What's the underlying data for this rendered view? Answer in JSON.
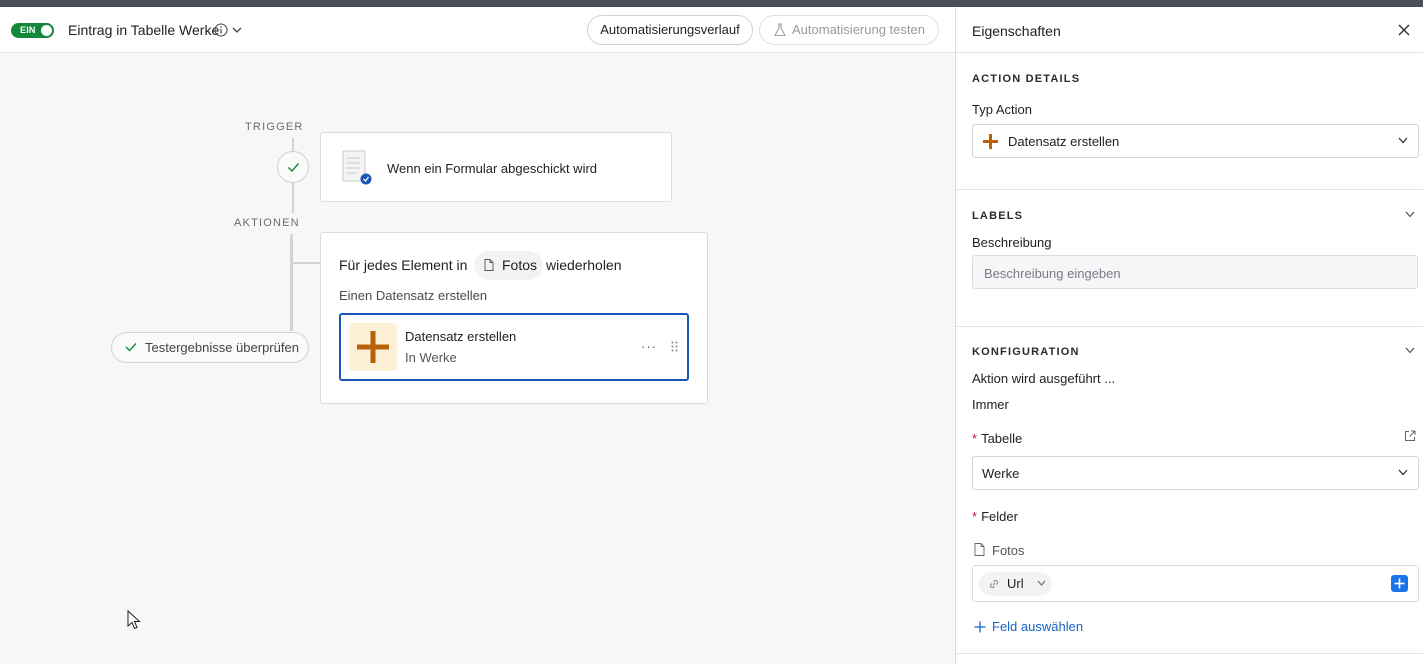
{
  "header": {
    "toggle_label": "EIN",
    "automation_title": "Eintrag in Tabelle Werke",
    "history_button": "Automatisierungsverlauf",
    "test_button": "Automatisierung testen"
  },
  "canvas": {
    "trigger_label": "TRIGGER",
    "actions_label": "AKTIONEN",
    "trigger_card_text": "Wenn ein Formular abgeschickt wird",
    "review_button": "Testergebnisse überprüfen",
    "loop": {
      "prefix": "Für jedes Element in",
      "chip": "Fotos",
      "suffix": "wiederholen",
      "subtitle": "Einen Datensatz erstellen"
    },
    "action": {
      "title": "Datensatz erstellen",
      "subtitle": "In Werke",
      "more": "···"
    }
  },
  "panel": {
    "title": "Eigenschaften",
    "action_details": {
      "heading": "ACTION DETAILS",
      "type_label": "Typ Action",
      "type_value": "Datensatz erstellen"
    },
    "labels": {
      "heading": "LABELS",
      "description_label": "Beschreibung",
      "description_placeholder": "Beschreibung eingeben"
    },
    "config": {
      "heading": "KONFIGURATION",
      "run_label": "Aktion wird ausgeführt ...",
      "run_value": "Immer",
      "table_label": "Tabelle",
      "table_value": "Werke",
      "fields_label": "Felder",
      "field_name": "Fotos",
      "field_chip": "Url",
      "add_field": "Feld auswählen"
    }
  },
  "colors": {
    "toggle_on": "#11883a",
    "accent_blue": "#1a56b8",
    "plus_orange": "#b8620a",
    "plus_bg": "#fdf0d7"
  }
}
